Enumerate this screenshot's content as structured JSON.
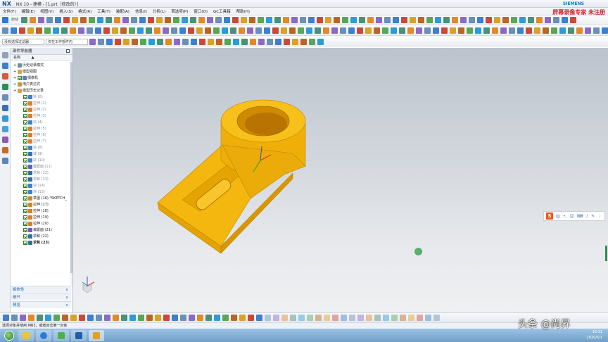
{
  "app": {
    "logo": "NX",
    "title": "NX 10 - 建模 - [1.prt（修改的）]",
    "brand": "SIEMENS"
  },
  "watermark_top": "屏幕录像专家 未注册",
  "menu": [
    "文件(F)",
    "编辑(E)",
    "视图(V)",
    "插入(S)",
    "格式(R)",
    "工具(T)",
    "装配(A)",
    "信息(I)",
    "分析(L)",
    "首选项(P)",
    "窗口(O)",
    "GC工具箱",
    "帮助(H)"
  ],
  "toolbar": {
    "start_label": "启动",
    "selection_filter": "没有选择过滤器",
    "assembly_scope": "仅在工作部件内"
  },
  "navigator": {
    "title": "部件导航器",
    "column_name": "名称",
    "items": [
      {
        "label": "历史记录模式",
        "level": 1,
        "checked": false,
        "icon_color": "#7a8a9a",
        "dim": false
      },
      {
        "label": "模型视图",
        "level": 1,
        "checked": false,
        "icon_color": "#d8a24a",
        "dim": false
      },
      {
        "label": "摄像机",
        "level": 1,
        "checked": true,
        "icon_color": "#5b7fb5",
        "dim": false
      },
      {
        "label": "用户表达式",
        "level": 1,
        "checked": false,
        "icon_color": "#c79a3a",
        "dim": false
      },
      {
        "label": "模型历史记录",
        "level": 1,
        "checked": false,
        "icon_color": "#d8a24a",
        "dim": false
      },
      {
        "label": "块 (0)",
        "level": 2,
        "checked": true,
        "icon_color": "#3f7fcf",
        "dim": true
      },
      {
        "label": "拉伸 (1)",
        "level": 2,
        "checked": true,
        "icon_color": "#e07b2a",
        "dim": true
      },
      {
        "label": "拉伸 (2)",
        "level": 2,
        "checked": true,
        "icon_color": "#e07b2a",
        "dim": true
      },
      {
        "label": "拉伸 (3)",
        "level": 2,
        "checked": true,
        "icon_color": "#e07b2a",
        "dim": true
      },
      {
        "label": "块 (4)",
        "level": 2,
        "checked": true,
        "icon_color": "#3f7fcf",
        "dim": true
      },
      {
        "label": "拉伸 (5)",
        "level": 2,
        "checked": true,
        "icon_color": "#e07b2a",
        "dim": true
      },
      {
        "label": "拉伸 (6)",
        "level": 2,
        "checked": true,
        "icon_color": "#e07b2a",
        "dim": true
      },
      {
        "label": "拉伸 (7)",
        "level": 2,
        "checked": true,
        "icon_color": "#e07b2a",
        "dim": true
      },
      {
        "label": "块 (8)",
        "level": 2,
        "checked": true,
        "icon_color": "#3f7fcf",
        "dim": true
      },
      {
        "label": "减 (9)",
        "level": 2,
        "checked": true,
        "icon_color": "#3a6fb0",
        "dim": true
      },
      {
        "label": "块 (10)",
        "level": 2,
        "checked": true,
        "icon_color": "#3f7fcf",
        "dim": true
      },
      {
        "label": "偏置面 (11)",
        "level": 2,
        "checked": true,
        "icon_color": "#6a5acd",
        "dim": true
      },
      {
        "label": "求和 (12)",
        "level": 2,
        "checked": true,
        "icon_color": "#2f6f9f",
        "dim": true
      },
      {
        "label": "求和 (13)",
        "level": 2,
        "checked": true,
        "icon_color": "#2f6f9f",
        "dim": true
      },
      {
        "label": "块 (14)",
        "level": 2,
        "checked": true,
        "icon_color": "#3f7fcf",
        "dim": true
      },
      {
        "label": "块 (15)",
        "level": 2,
        "checked": true,
        "icon_color": "#3f7fcf",
        "dim": true
      },
      {
        "label": "草图 (16) \"SKETCH_",
        "level": 2,
        "checked": true,
        "icon_color": "#c98a2a",
        "dim": false
      },
      {
        "label": "拉伸 (17)",
        "level": 2,
        "checked": true,
        "icon_color": "#e07b2a",
        "dim": false
      },
      {
        "label": "拉伸 (18)",
        "level": 2,
        "checked": true,
        "icon_color": "#e07b2a",
        "dim": false
      },
      {
        "label": "拉伸 (19)",
        "level": 2,
        "checked": true,
        "icon_color": "#e07b2a",
        "dim": false
      },
      {
        "label": "拉伸 (20)",
        "level": 2,
        "checked": true,
        "icon_color": "#e07b2a",
        "dim": false
      },
      {
        "label": "偏置面 (21)",
        "level": 2,
        "checked": true,
        "icon_color": "#6a5acd",
        "dim": false
      },
      {
        "label": "求和 (22)",
        "level": 2,
        "checked": true,
        "icon_color": "#2f6f9f",
        "dim": false
      },
      {
        "label": "求和 (23)",
        "level": 2,
        "checked": true,
        "icon_color": "#2f6f9f",
        "dim": false
      }
    ],
    "panels": [
      "相依性",
      "细节",
      "预览"
    ]
  },
  "model": {
    "body_color": "#f2b20c",
    "edge_color": "#c98a00"
  },
  "status_text": "选择对象并使用 MB3，或者双击某一对象",
  "ime": {
    "logo": "S",
    "mode": "中"
  },
  "taskbar": {
    "time": "19:31",
    "date": "2020/5/1"
  },
  "watermark_bottom": "头条 @尚昇"
}
